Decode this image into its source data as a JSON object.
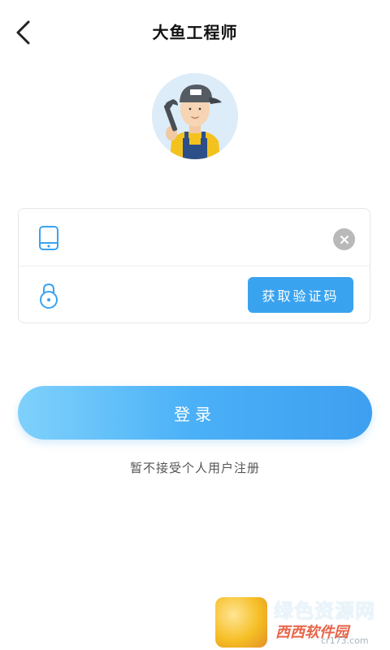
{
  "header": {
    "title": "大鱼工程师",
    "back_icon": "chevron-left-icon"
  },
  "avatar": {
    "icon": "engineer-avatar"
  },
  "form": {
    "phone": {
      "icon": "phone-icon",
      "value": "",
      "placeholder": "",
      "clear_icon": "close-icon"
    },
    "code": {
      "icon": "lock-icon",
      "value": "",
      "placeholder": "",
      "get_code_label": "获取验证码"
    }
  },
  "login": {
    "label": "登录"
  },
  "note": "暂不接受个人用户注册",
  "watermark": {
    "line1": "绿色资源网",
    "line2": "西西软件园",
    "url": "cr173.com"
  },
  "colors": {
    "accent": "#3aa3ef",
    "login_gradient_start": "#7fd1fb",
    "login_gradient_end": "#3e9ff0",
    "clear_button": "#b9b9b9"
  }
}
